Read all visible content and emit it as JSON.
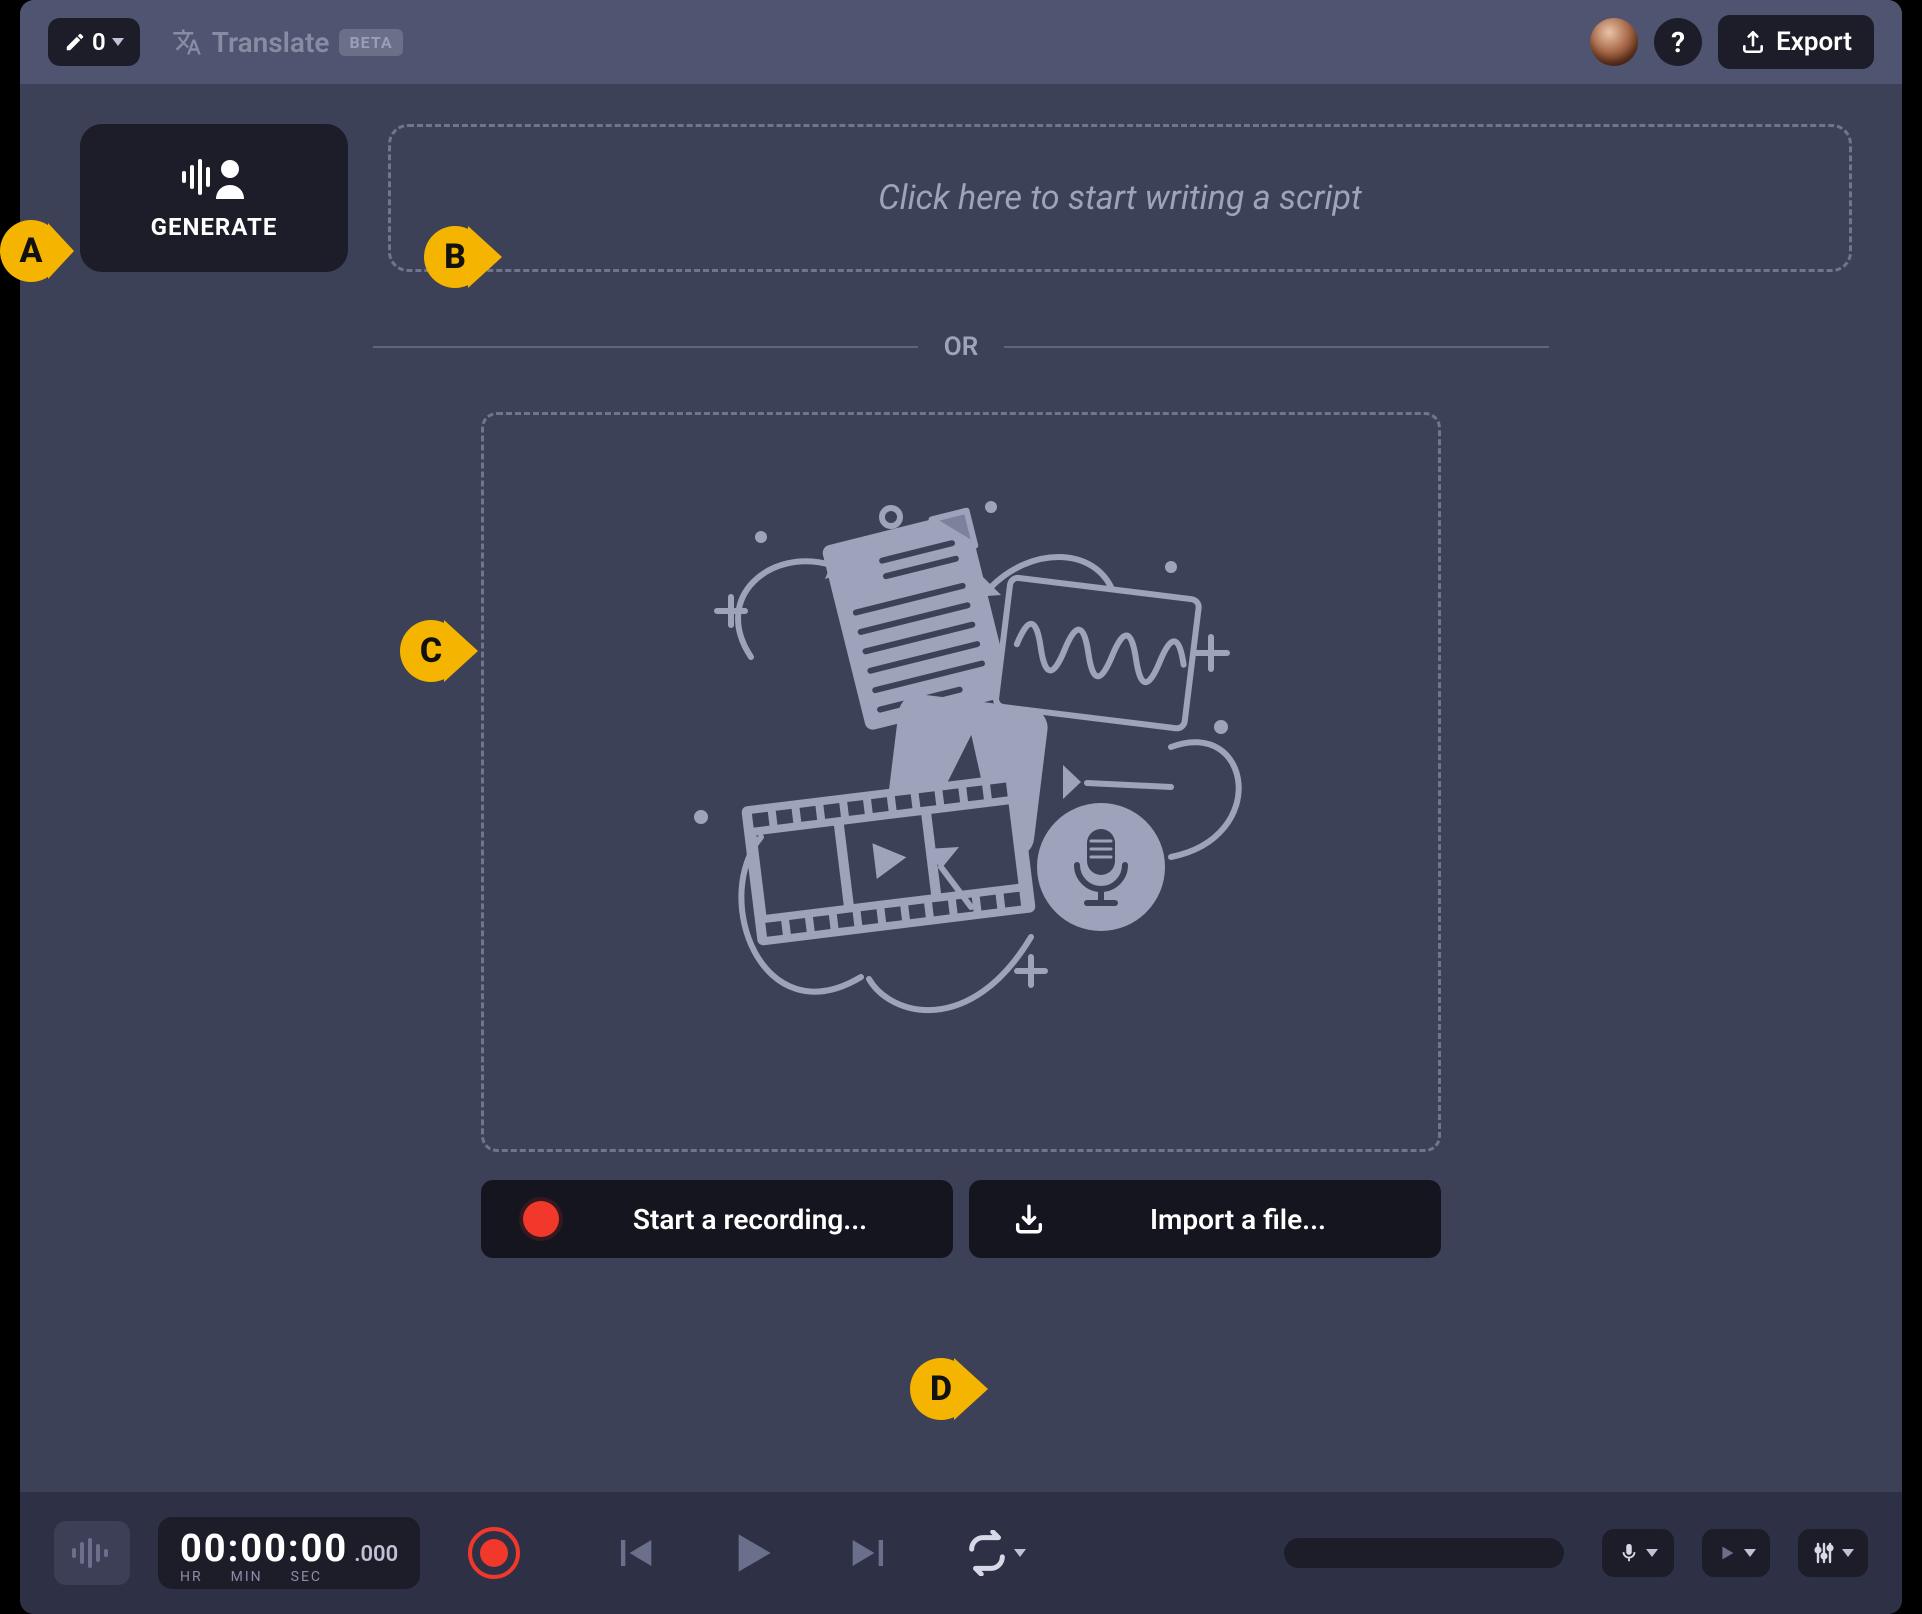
{
  "topbar": {
    "pencil_count": "0",
    "translate_label": "Translate",
    "beta_badge": "BETA",
    "help_label": "?",
    "export_label": "Export"
  },
  "main": {
    "generate_label": "GENERATE",
    "script_placeholder": "Click here to start writing a script",
    "or_label": "OR",
    "start_recording_label": "Start a recording...",
    "import_file_label": "Import a file..."
  },
  "markers": {
    "a": "A",
    "b": "B",
    "c": "C",
    "d": "D"
  },
  "bottombar": {
    "timecode": "00:00:00",
    "timecode_ms": ".000",
    "hr_label": "HR",
    "min_label": "MIN",
    "sec_label": "SEC"
  }
}
